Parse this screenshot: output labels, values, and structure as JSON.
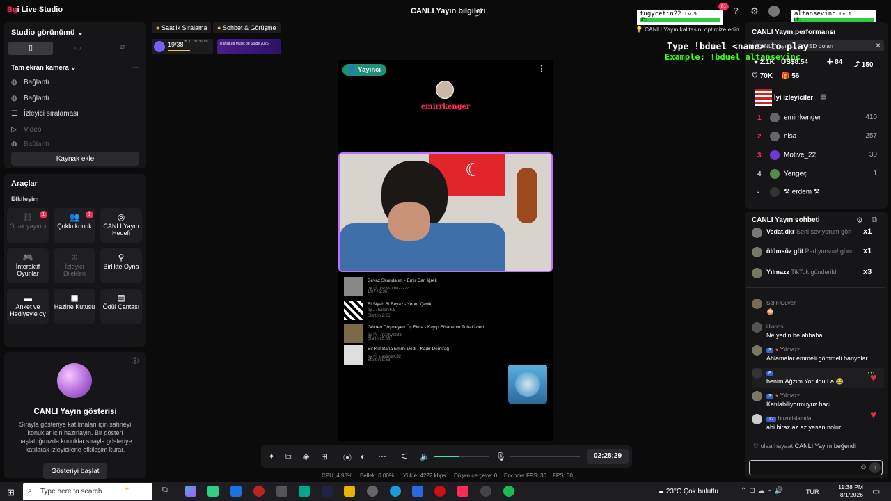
{
  "app": {
    "logo_a": "Bg",
    "logo_b": "i Live Studio",
    "center_title": "CANLI Yayın bilgileri",
    "notif_count": "61"
  },
  "left": {
    "studio_view": "Studio görünümü",
    "camera_group": "Tam ekran kamera",
    "sources": [
      "Bağlantı",
      "Bağlantı",
      "İzleyici sıralaması",
      "Video",
      "Bağlantı"
    ],
    "add_source": "Kaynak ekle",
    "tools_title": "Araçlar",
    "interaction": "Etkileşim",
    "tools": [
      {
        "label": "Ortak yayıncı",
        "badge": "1"
      },
      {
        "label": "Çoklu konuk",
        "badge": "1"
      },
      {
        "label": "CANLI Yayın Hedefi"
      },
      {
        "label": "İnteraktif Oyunlar"
      },
      {
        "label": "İzleyici Dilekleri"
      },
      {
        "label": "Birlikte Oyna"
      },
      {
        "label": "Anket ve Hediyeyle oy"
      },
      {
        "label": "Hazine Kutusu"
      },
      {
        "label": "Ödül Çantası"
      }
    ],
    "show_title": "CANLI Yayın gösterisi",
    "show_desc": "Sırayla gösteriye katılmaları için sahneyi konuklar için hazırlayın. Bir gösteri başlattığınızda konuklar sırayla gösteriye katılarak izleyicilerle etkileşim kurar.",
    "show_button": "Gösteriyi başlat"
  },
  "center": {
    "chip_ranking": "Saatlik Sıralama",
    "chip_chat": "Sohbet & Görüşme",
    "goal": "19/38",
    "goal_sub": "m 31 dk 36 sn",
    "promo": "d'arisa.es Music on Stage 2026",
    "host_badge": "Yayıncı",
    "host_name": "emirrkenger",
    "songs": [
      {
        "title": "Beyaz Skandalım - Emir Can İğrek",
        "by": "by ⓜ nisossumuzzzzz",
        "meta": "1:07 / 3:35"
      },
      {
        "title": "Bi Siyah Bi Beyaz - Yener Çevik",
        "by": "by  ... haranı6.5",
        "meta": "Start in 2:25"
      },
      {
        "title": "Gökten Düşmeyen Üç Elma - Kayıp Efsanenin Tuhaf İzleri",
        "by": "by ⓜ ..malikyzz33",
        "meta": "Start in 5:35"
      },
      {
        "title": "Bir Kız Bana Emmi Dedi - Kadir Demirağ",
        "by": "by ⓜ iuasjmen.32",
        "meta": "Start in 9:53"
      }
    ],
    "timer": "02:28:29",
    "stats": {
      "cpu": "CPU: 4.95%",
      "mem": "Bellek: 0.00%",
      "upload": "Yükle: 4222 kbps",
      "dropped": "Düşen çerçeve: 0",
      "enc": "Encoder FPS: 30",
      "fps": "FPS: 30"
    }
  },
  "overlay": {
    "user1": "tugycetin22",
    "user1_lvl": "Lv.9",
    "hp": "HP:",
    "user2": "altansevinc",
    "user2_lvl": "Lv.1",
    "type_line": "Type !bduel <name> to play",
    "example_line": "Example: !bduel altansevinc",
    "quality_tip": "CANLI Yayın kalitesini optimize edin"
  },
  "right": {
    "perf_title": "CANLI Yayın performansı",
    "promo_text": "CANLI Yayın ... ... USD doları",
    "metrics": [
      "2.1K",
      "US$8.54",
      "84",
      "150"
    ],
    "likes": "70K",
    "gifts": "56",
    "top_viewers_tab": "İyi izleyiciler",
    "ranking": [
      {
        "rank": "1",
        "name": "emirrkenger",
        "score": "410"
      },
      {
        "rank": "2",
        "name": "nisa",
        "score": "257"
      },
      {
        "rank": "3",
        "name": "Motive_22",
        "score": "30"
      },
      {
        "rank": "4",
        "name": "Yengeç",
        "score": "1"
      },
      {
        "rank": "-",
        "name": "⚒ erdem ⚒",
        "score": ""
      }
    ],
    "chat_title": "CANLI Yayın sohbeti",
    "gifts_list": [
      {
        "user": "Vedat.dkr",
        "msg": "Seni seviyorum gön",
        "x": "x1"
      },
      {
        "user": "ölümsüz göt",
        "msg": "Parlıyorsun! gönc",
        "x": "x1"
      },
      {
        "user": "Yılmazz",
        "msg": "TikTok gönderildi",
        "x": "x3"
      }
    ],
    "messages": [
      {
        "name": "Selin Güven",
        "lvl": "",
        "text": "🧅"
      },
      {
        "name": "illiooos",
        "lvl": "",
        "text": "Ne yedin be ahhaha"
      },
      {
        "name": "Yılmazz",
        "lvl": "3",
        "text": "Ahlamalar emmeli gömmeli banyolar"
      },
      {
        "name": "",
        "lvl": "8",
        "text": "benim Ağzım Yoruldu La 😂"
      },
      {
        "name": "Yılmazz",
        "lvl": "3",
        "text": "Katılabiliyormuyuz hacı"
      },
      {
        "name": "huzurislamda",
        "lvl": "12",
        "text": "abi biraz az az yesen nolur"
      }
    ],
    "like_event": {
      "user": "ulaa hayaat",
      "text": "CANLI Yayını beğendi"
    }
  },
  "taskbar": {
    "search": "Type here to search",
    "weather": "23°C  Çok bulutlu",
    "lang": "TUR",
    "time": "11:38 PM",
    "date": "8/1/2026"
  }
}
